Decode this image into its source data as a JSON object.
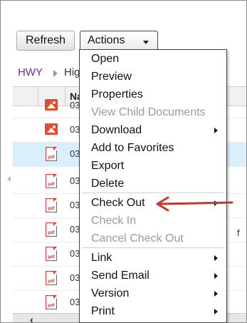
{
  "toolbar": {
    "refresh_label": "Refresh",
    "actions_label": "Actions"
  },
  "breadcrumb": {
    "root": "HWY",
    "current": "Hig"
  },
  "table": {
    "name_header": "Na",
    "rows": [
      {
        "date": "03",
        "icon": "image-file-icon",
        "selected": false
      },
      {
        "date": "03",
        "icon": "image-file-icon",
        "selected": false
      },
      {
        "date": "03",
        "icon": "pdf-file-icon",
        "selected": true
      },
      {
        "date": "03",
        "icon": "pdf-file-icon",
        "selected": false
      },
      {
        "date": "03",
        "icon": "pdf-file-icon",
        "selected": false
      },
      {
        "date": "03",
        "icon": "pdf-file-icon",
        "selected": false
      },
      {
        "date": "03",
        "icon": "pdf-file-icon",
        "selected": false
      },
      {
        "date": "03",
        "icon": "pdf-file-icon",
        "selected": false
      },
      {
        "date": "03",
        "icon": "pdf-file-icon",
        "selected": false
      }
    ],
    "overflow_text": "f"
  },
  "menu": {
    "open": "Open",
    "preview": "Preview",
    "properties": "Properties",
    "view_child": "View Child Documents",
    "download": "Download",
    "add_favorites": "Add to Favorites",
    "export": "Export",
    "delete": "Delete",
    "check_out": "Check Out",
    "check_in": "Check In",
    "cancel_check_out": "Cancel Check Out",
    "link": "Link",
    "send_email": "Send Email",
    "version": "Version",
    "print": "Print"
  },
  "colors": {
    "annotation_arrow": "#c0392b",
    "selected_row": "#dbeefb",
    "pdf_red": "#dd3333",
    "breadcrumb_link": "#6a2c91"
  }
}
